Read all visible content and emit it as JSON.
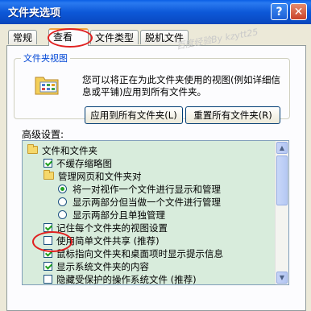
{
  "window": {
    "title": "文件夹选项",
    "help_label": "?",
    "close_label": "✕"
  },
  "tabs": [
    {
      "label": "常规"
    },
    {
      "label": "查看"
    },
    {
      "label": "文件类型"
    },
    {
      "label": "脱机文件"
    }
  ],
  "watermark": "百度经验By kzytt25",
  "folder_views": {
    "legend": "文件夹视图",
    "description": "您可以将正在为此文件夹使用的视图(例如详细信息或平铺)应用到所有文件夹。",
    "apply_all_label": "应用到所有文件夹(L)",
    "reset_all_label": "重置所有文件夹(R)"
  },
  "advanced": {
    "label": "高级设置:",
    "items": [
      {
        "type": "folder",
        "label": "文件和文件夹"
      },
      {
        "type": "checkbox",
        "checked": true,
        "label": "不缓存缩略图"
      },
      {
        "type": "folder",
        "label": "管理网页和文件夹对"
      },
      {
        "type": "radio",
        "checked": true,
        "label": "将一对视作一个文件进行显示和管理"
      },
      {
        "type": "radio",
        "checked": false,
        "label": "显示两部分但当做一个文件进行管理"
      },
      {
        "type": "radio",
        "checked": false,
        "label": "显示两部分且单独管理"
      },
      {
        "type": "checkbox",
        "checked": true,
        "label": "记住每个文件夹的视图设置"
      },
      {
        "type": "checkbox",
        "checked": false,
        "label": "使用简单文件共享 (推荐)"
      },
      {
        "type": "checkbox",
        "checked": true,
        "label": "鼠标指向文件夹和桌面项时显示提示信息"
      },
      {
        "type": "checkbox",
        "checked": true,
        "label": "显示系统文件夹的内容"
      },
      {
        "type": "checkbox",
        "checked": false,
        "label": "隐藏受保护的操作系统文件 (推荐)"
      }
    ]
  }
}
